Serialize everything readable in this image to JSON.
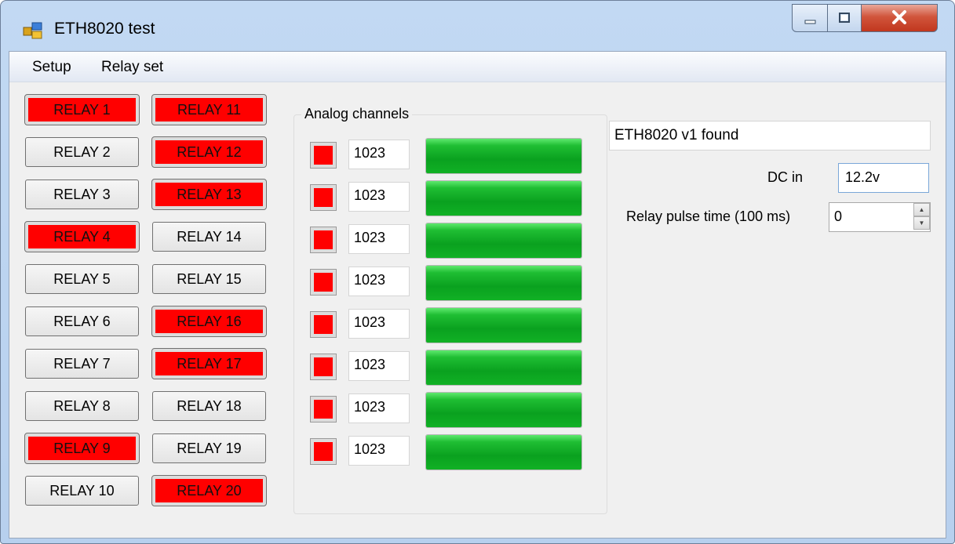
{
  "window": {
    "title": "ETH8020 test"
  },
  "menu": [
    "Setup",
    "Relay set"
  ],
  "relays": [
    {
      "label": "RELAY 1",
      "on": true
    },
    {
      "label": "RELAY 2",
      "on": false
    },
    {
      "label": "RELAY 3",
      "on": false
    },
    {
      "label": "RELAY 4",
      "on": true
    },
    {
      "label": "RELAY 5",
      "on": false
    },
    {
      "label": "RELAY 6",
      "on": false
    },
    {
      "label": "RELAY 7",
      "on": false
    },
    {
      "label": "RELAY 8",
      "on": false
    },
    {
      "label": "RELAY 9",
      "on": true
    },
    {
      "label": "RELAY 10",
      "on": false
    },
    {
      "label": "RELAY 11",
      "on": true
    },
    {
      "label": "RELAY 12",
      "on": true
    },
    {
      "label": "RELAY 13",
      "on": true
    },
    {
      "label": "RELAY 14",
      "on": false
    },
    {
      "label": "RELAY 15",
      "on": false
    },
    {
      "label": "RELAY 16",
      "on": true
    },
    {
      "label": "RELAY 17",
      "on": true
    },
    {
      "label": "RELAY 18",
      "on": false
    },
    {
      "label": "RELAY 19",
      "on": false
    },
    {
      "label": "RELAY 20",
      "on": true
    }
  ],
  "analog": {
    "title": "Analog channels",
    "channels": [
      {
        "value": "1023",
        "level": 1.0
      },
      {
        "value": "1023",
        "level": 1.0
      },
      {
        "value": "1023",
        "level": 1.0
      },
      {
        "value": "1023",
        "level": 1.0
      },
      {
        "value": "1023",
        "level": 1.0
      },
      {
        "value": "1023",
        "level": 1.0
      },
      {
        "value": "1023",
        "level": 1.0
      },
      {
        "value": "1023",
        "level": 1.0
      }
    ]
  },
  "status": "ETH8020 v1 found",
  "dc": {
    "label": "DC in",
    "value": "12.2v"
  },
  "pulse": {
    "label": "Relay pulse time (100 ms)",
    "value": "0"
  },
  "colors": {
    "relay_on": "#ff0000",
    "bar_fill": "#0aa11f",
    "indicator": "#ff0000"
  }
}
